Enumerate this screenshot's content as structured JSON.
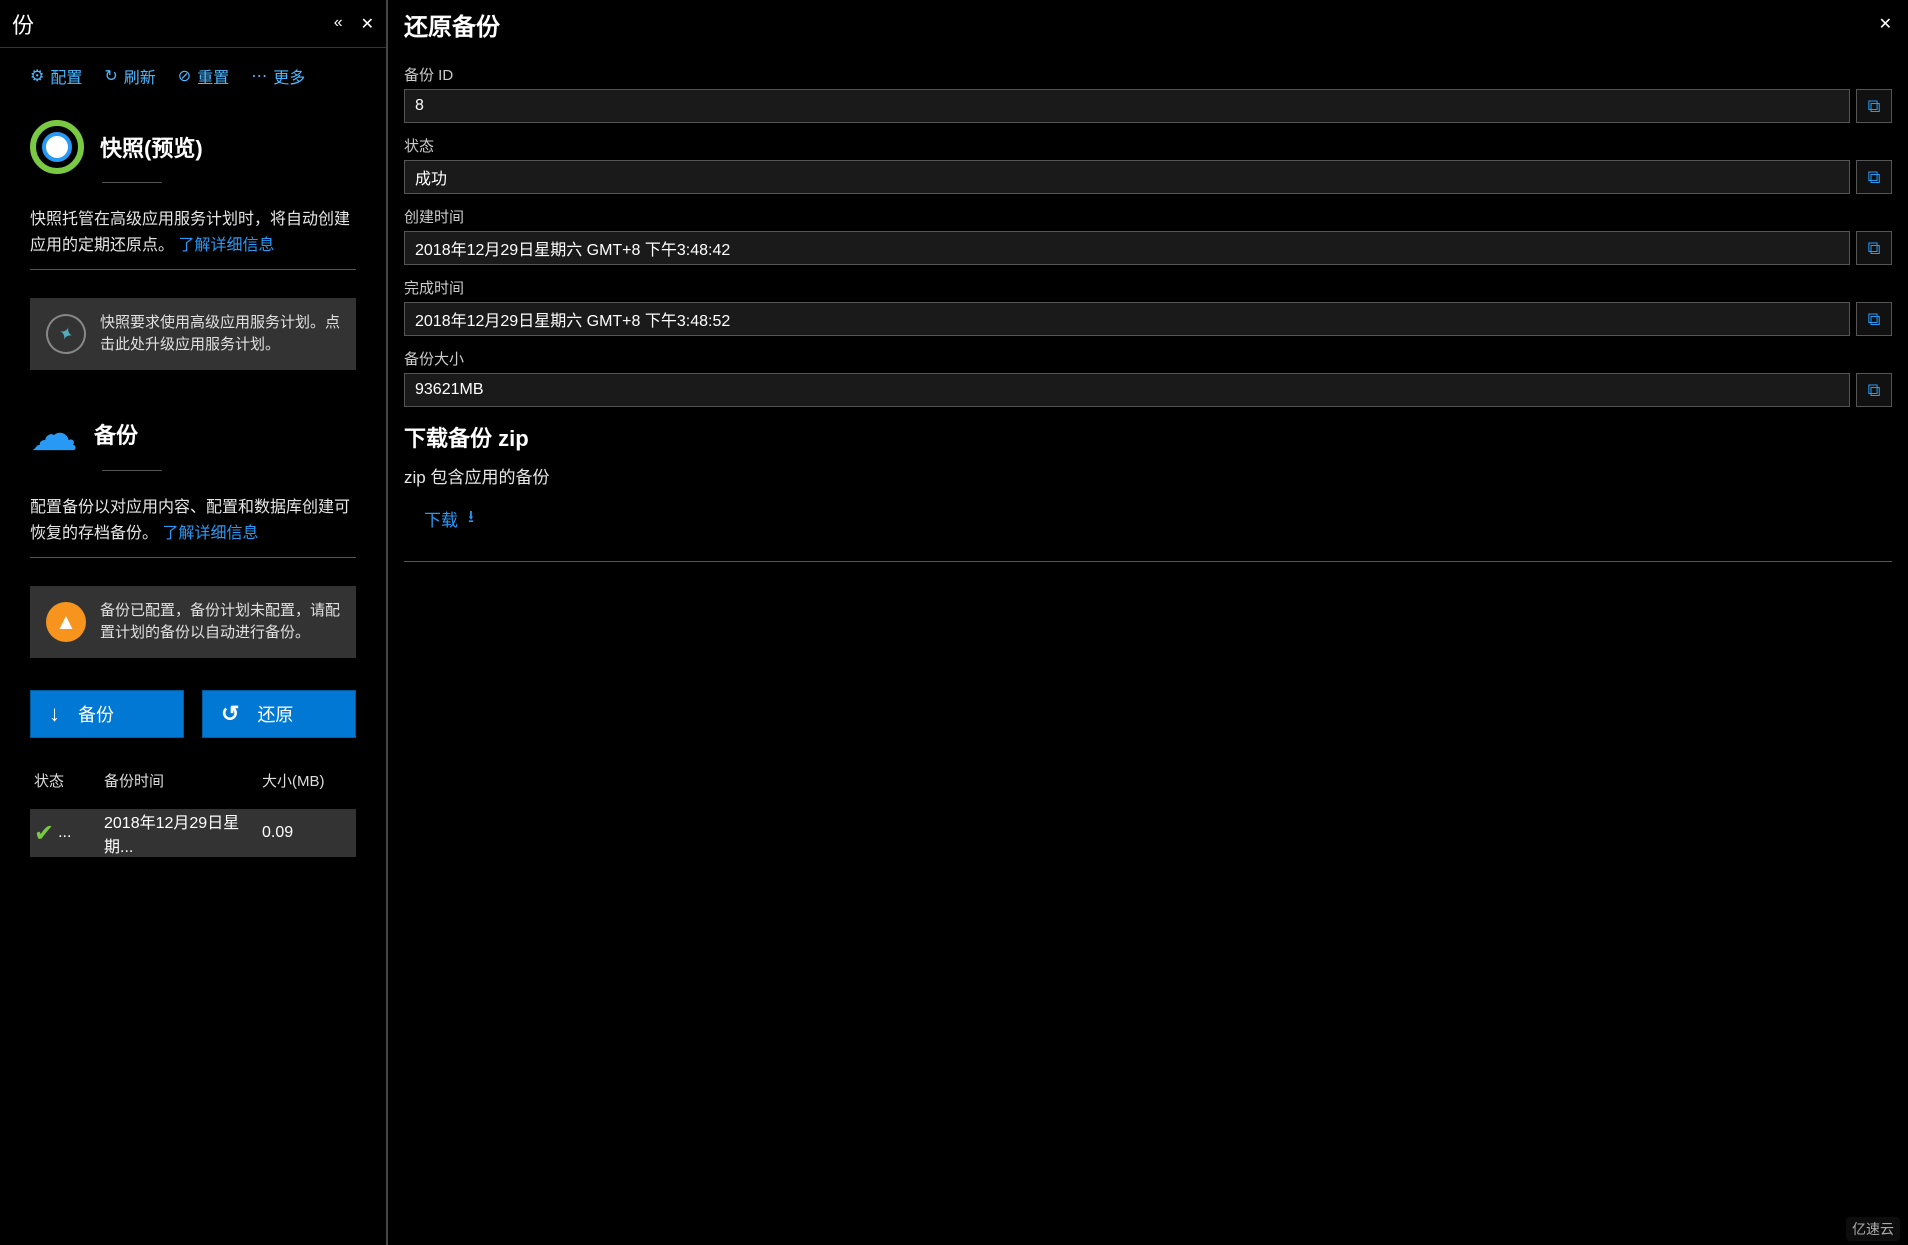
{
  "left": {
    "panel_title": "份",
    "toolbar": {
      "configure": "配置",
      "refresh": "刷新",
      "reset": "重置",
      "more": "更多"
    },
    "snapshot": {
      "title": "快照(预览)",
      "desc": "快照托管在高级应用服务计划时，将自动创建应用的定期还原点。",
      "link": "了解详细信息",
      "notice": "快照要求使用高级应用服务计划。点击此处升级应用服务计划。"
    },
    "backup": {
      "title": "备份",
      "desc": "配置备份以对应用内容、配置和数据库创建可恢复的存档备份。",
      "link": "了解详细信息",
      "notice": "备份已配置，备份计划未配置，请配置计划的备份以自动进行备份。"
    },
    "actions": {
      "backup": "备份",
      "restore": "还原"
    },
    "table": {
      "headers": {
        "status": "状态",
        "time": "备份时间",
        "size": "大小(MB)"
      },
      "rows": [
        {
          "status": "success",
          "time": "2018年12月29日星期...",
          "size": "0.09"
        }
      ]
    }
  },
  "right": {
    "title": "还原备份",
    "fields": {
      "id": {
        "label": "备份 ID",
        "value": "8"
      },
      "status": {
        "label": "状态",
        "value": "成功"
      },
      "created": {
        "label": "创建时间",
        "value": "2018年12月29日星期六 GMT+8 下午3:48:42"
      },
      "finished": {
        "label": "完成时间",
        "value": "2018年12月29日星期六 GMT+8 下午3:48:52"
      },
      "size": {
        "label": "备份大小",
        "value": "93621MB"
      }
    },
    "download": {
      "heading": "下载备份 zip",
      "text": "zip 包含应用的备份",
      "link": "下载"
    }
  },
  "watermark": "亿速云"
}
